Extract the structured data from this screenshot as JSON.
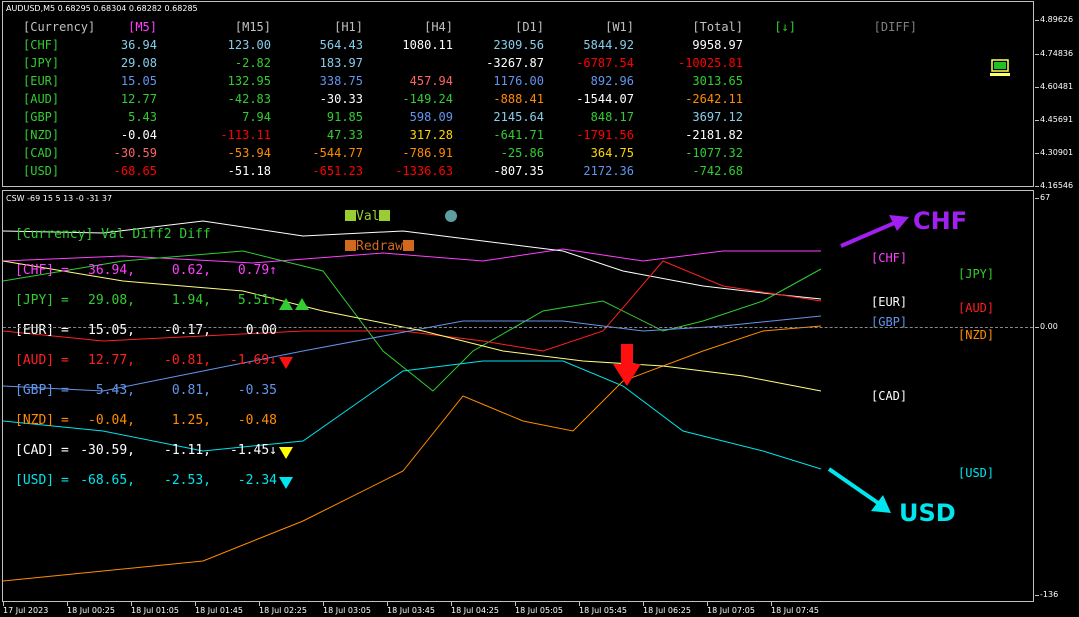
{
  "top_pane": {
    "header": "AUDUSD,M5  0.68295 0.68304 0.68282 0.68285",
    "columns": [
      "[Currency]",
      "[M5]",
      "[M15]",
      "[H1]",
      "[H4]",
      "[D1]",
      "[W1]",
      "[Total]",
      "[↓]",
      "[DIFF]"
    ],
    "column_colors": [
      "#c0c0c0",
      "#ff40ff",
      "#c0c0c0",
      "#c0c0c0",
      "#c0c0c0",
      "#c0c0c0",
      "#c0c0c0",
      "#c0c0c0",
      "#32cd32",
      "#808080"
    ],
    "rows": [
      {
        "cur": "[CHF]",
        "vals": [
          "36.94",
          "123.00",
          "564.43",
          "1080.11",
          "2309.56",
          "5844.92",
          "9958.97"
        ]
      },
      {
        "cur": "[JPY]",
        "vals": [
          "29.08",
          "-2.82",
          "183.97",
          "-3267.87",
          "-6787.54",
          "-10025.81"
        ]
      },
      {
        "cur": "[EUR]",
        "vals": [
          "15.05",
          "132.95",
          "338.75",
          "457.94",
          "1176.00",
          "892.96",
          "3013.65"
        ]
      },
      {
        "cur": "[AUD]",
        "vals": [
          "12.77",
          "-42.83",
          "-30.33",
          "-149.24",
          "-888.41",
          "-1544.07",
          "-2642.11"
        ]
      },
      {
        "cur": "[GBP]",
        "vals": [
          "5.43",
          "7.94",
          "91.85",
          "598.09",
          "2145.64",
          "848.17",
          "3697.12"
        ]
      },
      {
        "cur": "[NZD]",
        "vals": [
          "-0.04",
          "-113.11",
          "47.33",
          "317.28",
          "-641.71",
          "-1791.56",
          "-2181.82"
        ]
      },
      {
        "cur": "[CAD]",
        "vals": [
          "-30.59",
          "-53.94",
          "-544.77",
          "-786.91",
          "-25.86",
          "364.75",
          "-1077.32"
        ]
      },
      {
        "cur": "[USD]",
        "vals": [
          "-68.65",
          "-51.18",
          "-651.23",
          "-1336.63",
          "-807.35",
          "2172.36",
          "-742.68"
        ]
      }
    ],
    "row_colors": [
      [
        "#87ceeb",
        "#87ceeb",
        "#87ceeb",
        "#ffffff",
        "#87ceeb",
        "#87ceeb",
        "#ffffff"
      ],
      [
        "#87ceeb",
        "#32cd32",
        "#87ceeb",
        "#ffffff",
        "#ff0000",
        "#ff0000",
        "#ff0000"
      ],
      [
        "#6495ed",
        "#32cd32",
        "#6495ed",
        "#ff6464",
        "#6495ed",
        "#6495ed",
        "#32cd32"
      ],
      [
        "#32cd32",
        "#32cd32",
        "#ffffff",
        "#32cd32",
        "#ff8c00",
        "#ffffff",
        "#ff8c00"
      ],
      [
        "#32cd32",
        "#32cd32",
        "#32cd32",
        "#6495ed",
        "#87ceeb",
        "#32cd32",
        "#87ceeb"
      ],
      [
        "#ffffff",
        "#ff0000",
        "#32cd32",
        "#ffd700",
        "#32cd32",
        "#ff0000",
        "#ffffff"
      ],
      [
        "#ff6464",
        "#ff8c00",
        "#ff8c00",
        "#ff8c00",
        "#32cd32",
        "#ffd700",
        "#32cd32"
      ],
      [
        "#ff0000",
        "#ffffff",
        "#ff0000",
        "#ff0000",
        "#ffffff",
        "#6495ed",
        "#32cd32"
      ]
    ],
    "y_ticks": [
      "4.89626",
      "4.74836",
      "4.60481",
      "4.45691",
      "4.30901",
      "4.16546"
    ]
  },
  "bottom_pane": {
    "header": "CSW -69 15 5 13 -0 -31 37",
    "legend_val": "Val",
    "legend_redraw": "Redraw",
    "table_header": "[Currency]  Val   Diff2   Diff",
    "rows": [
      {
        "cur": "[CHF]",
        "val": "36.94,",
        "diff2": "0.62,",
        "diff": "0.79↑",
        "color": "#ff40ff"
      },
      {
        "cur": "[JPY]",
        "val": "29.08,",
        "diff2": "1.94,",
        "diff": "5.51↑",
        "color": "#32cd32"
      },
      {
        "cur": "[EUR]",
        "val": "15.05,",
        "diff2": "-0.17,",
        "diff": "0.00",
        "color": "#ffffff"
      },
      {
        "cur": "[AUD]",
        "val": "12.77,",
        "diff2": "-0.81,",
        "diff": "-1.69↓",
        "color": "#ff2020"
      },
      {
        "cur": "[GBP]",
        "val": "5.43,",
        "diff2": "0.81,",
        "diff": "-0.35",
        "color": "#6495ed"
      },
      {
        "cur": "[NZD]",
        "val": "-0.04,",
        "diff2": "1.25,",
        "diff": "-0.48",
        "color": "#ff8c00"
      },
      {
        "cur": "[CAD]",
        "val": "-30.59,",
        "diff2": "-1.11,",
        "diff": "-1.45↓",
        "color": "#ffffff"
      },
      {
        "cur": "[USD]",
        "val": "-68.65,",
        "diff2": "-2.53,",
        "diff": "-2.34",
        "color": "#00e5ee"
      }
    ],
    "y_ticks": [
      "67",
      "0.00",
      "-136"
    ],
    "right_labels": [
      {
        "text": "[CHF]",
        "color": "#ff40ff"
      },
      {
        "text": "[JPY]",
        "color": "#32cd32"
      },
      {
        "text": "[EUR]",
        "color": "#ffffff"
      },
      {
        "text": "[AUD]",
        "color": "#ff2020"
      },
      {
        "text": "[GBP]",
        "color": "#6495ed"
      },
      {
        "text": "[NZD]",
        "color": "#ff8c00"
      },
      {
        "text": "[CAD]",
        "color": "#ffffff"
      },
      {
        "text": "[USD]",
        "color": "#00e5ee"
      }
    ],
    "annot_chf": "CHF",
    "annot_usd": "USD"
  },
  "x_ticks": [
    "17 Jul 2023",
    "18 Jul 00:25",
    "18 Jul 01:05",
    "18 Jul 01:45",
    "18 Jul 02:25",
    "18 Jul 03:05",
    "18 Jul 03:45",
    "18 Jul 04:25",
    "18 Jul 05:05",
    "18 Jul 05:45",
    "18 Jul 06:25",
    "18 Jul 07:05",
    "18 Jul 07:45"
  ],
  "icons": {
    "monitor": "monitor-icon"
  }
}
